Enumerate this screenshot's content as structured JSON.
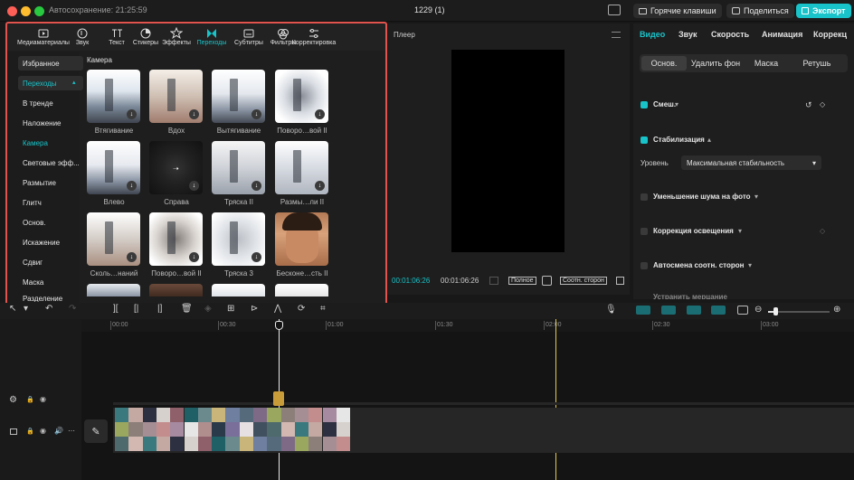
{
  "titlebar": {
    "autosave": "Автосохранение: 21:25:59",
    "project": "1229 (1)",
    "hotkeys": "Горячие клавиши",
    "share": "Поделиться",
    "export": "Экспорт"
  },
  "toolbar": [
    {
      "label": "Медиаматериалы",
      "icon": "media-icon"
    },
    {
      "label": "Звук",
      "icon": "audio-icon"
    },
    {
      "label": "Текст",
      "icon": "text-icon"
    },
    {
      "label": "Стикеры",
      "icon": "sticker-icon"
    },
    {
      "label": "Эффекты",
      "icon": "effects-icon"
    },
    {
      "label": "Переходы",
      "icon": "transitions-icon"
    },
    {
      "label": "Субтитры",
      "icon": "subtitles-icon"
    },
    {
      "label": "Фильтры",
      "icon": "filters-icon"
    },
    {
      "label": "Корректировка",
      "icon": "adjust-icon"
    }
  ],
  "sidebar": [
    {
      "label": "Избранное"
    },
    {
      "label": "Переходы"
    },
    {
      "label": "В тренде"
    },
    {
      "label": "Наложение"
    },
    {
      "label": "Камера"
    },
    {
      "label": "Световые эфф..."
    },
    {
      "label": "Размытие"
    },
    {
      "label": "Глитч"
    },
    {
      "label": "Основ."
    },
    {
      "label": "Искажение"
    },
    {
      "label": "Сдвиг"
    },
    {
      "label": "Маска"
    },
    {
      "label": "Разделение"
    }
  ],
  "section_title": "Камера",
  "items": [
    {
      "label": "Втягивание"
    },
    {
      "label": "Вдох"
    },
    {
      "label": "Вытягивание"
    },
    {
      "label": "Поворо…вой II"
    },
    {
      "label": "Влево"
    },
    {
      "label": "Справа"
    },
    {
      "label": "Тряска II"
    },
    {
      "label": "Размы…ли II"
    },
    {
      "label": "Сколь…наний"
    },
    {
      "label": "Поворо…вой II"
    },
    {
      "label": "Тряска 3"
    },
    {
      "label": "Бесконе…сть II"
    }
  ],
  "player": {
    "title": "Плеер",
    "current": "00:01:06:26",
    "total": "00:01:06:26",
    "full_btn": "Полное",
    "ratio_btn": "Соотн. сторон"
  },
  "inspector": {
    "tabs": [
      "Видео",
      "Звук",
      "Скорость",
      "Анимация",
      "Коррекция"
    ],
    "subtabs": [
      "Основ.",
      "Удалить фон",
      "Маска",
      "Ретушь"
    ],
    "blend": "Смеш.",
    "stabilization": "Стабилизация",
    "level_label": "Уровень",
    "level_value": "Максимальная стабильность",
    "denoise": "Уменьшение шума на фото",
    "lighting": "Коррекция освещения",
    "auto_ratio": "Автосмена соотн. сторон",
    "partial": "Устранить мерцание"
  },
  "ruler": [
    "00:00",
    "00:30",
    "01:00",
    "01:30",
    "02:00",
    "02:30",
    "03:00"
  ],
  "colors": {
    "accent": "#18c3c9",
    "highlight_border": "#e2534d"
  }
}
